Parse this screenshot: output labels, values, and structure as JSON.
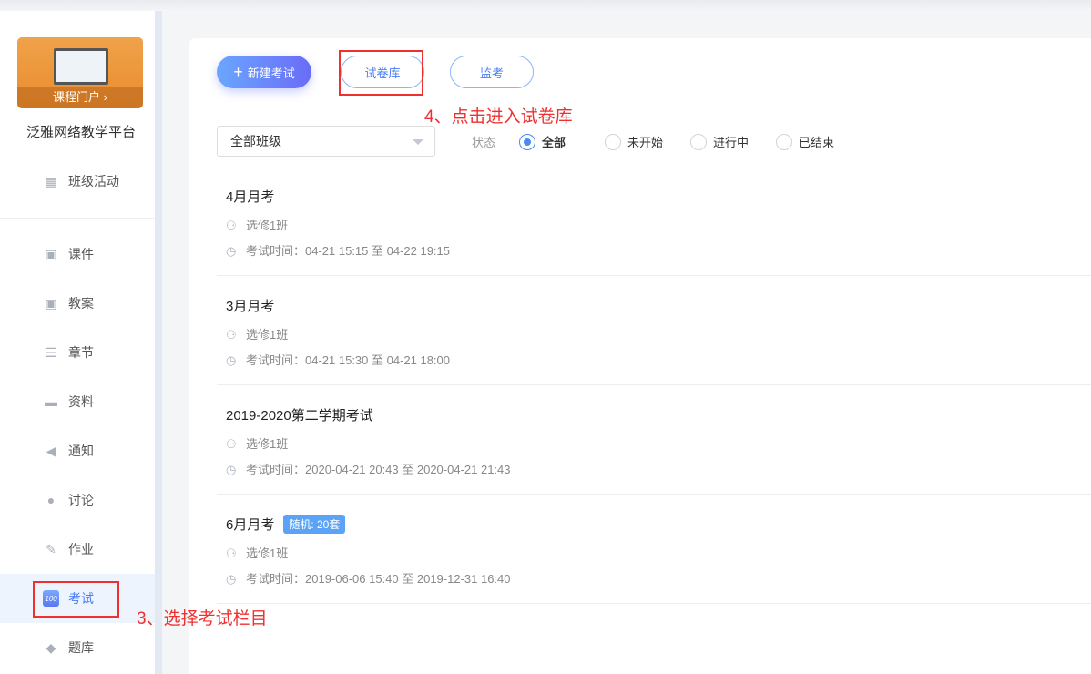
{
  "sidebar": {
    "banner_label": "课程门户 ›",
    "platform": "泛雅网络教学平台",
    "top_item": "班级活动",
    "items": [
      {
        "label": "课件",
        "icon": "ppt-icon"
      },
      {
        "label": "教案",
        "icon": "lesson-plan-icon"
      },
      {
        "label": "章节",
        "icon": "list-icon"
      },
      {
        "label": "资料",
        "icon": "folder-icon"
      },
      {
        "label": "通知",
        "icon": "speaker-icon"
      },
      {
        "label": "讨论",
        "icon": "chat-icon"
      },
      {
        "label": "作业",
        "icon": "homework-icon"
      },
      {
        "label": "考试",
        "icon": "exam-100-icon"
      },
      {
        "label": "题库",
        "icon": "layers-icon"
      }
    ]
  },
  "toolbar": {
    "new_exam": "新建考试",
    "paper_bank": "试卷库",
    "proctor": "监考"
  },
  "annotations": {
    "step4": "4、点击进入试卷库",
    "step3": "3、选择考试栏目"
  },
  "filter": {
    "class_select": "全部班级",
    "status_label": "状态",
    "options": [
      "全部",
      "未开始",
      "进行中",
      "已结束"
    ],
    "selected": "全部"
  },
  "exams": [
    {
      "title": "4月月考",
      "class": "选修1班",
      "time": "考试时间：04-21 15:15 至 04-22 19:15"
    },
    {
      "title": "3月月考",
      "class": "选修1班",
      "time": "考试时间：04-21 15:30 至 04-21 18:00"
    },
    {
      "title": "2019-2020第二学期考试",
      "class": "选修1班",
      "time": "考试时间：2020-04-21 20:43 至 2020-04-21 21:43"
    },
    {
      "title": "6月月考",
      "badge": "随机: 20套",
      "class": "选修1班",
      "time": "考试时间：2019-06-06 15:40 至 2019-12-31 16:40"
    }
  ],
  "colors": {
    "accent": "#4a7ef5",
    "annotation": "#f03030",
    "badge": "#5ba3f7"
  }
}
